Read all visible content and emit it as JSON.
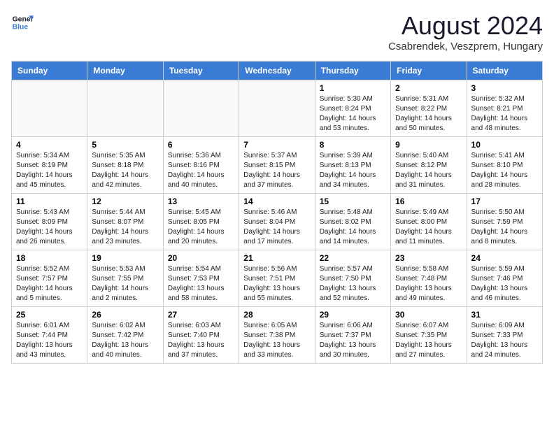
{
  "header": {
    "logo_line1": "General",
    "logo_line2": "Blue",
    "month_year": "August 2024",
    "location": "Csabrendek, Veszprem, Hungary"
  },
  "days_of_week": [
    "Sunday",
    "Monday",
    "Tuesday",
    "Wednesday",
    "Thursday",
    "Friday",
    "Saturday"
  ],
  "weeks": [
    [
      {
        "day": "",
        "info": ""
      },
      {
        "day": "",
        "info": ""
      },
      {
        "day": "",
        "info": ""
      },
      {
        "day": "",
        "info": ""
      },
      {
        "day": "1",
        "info": "Sunrise: 5:30 AM\nSunset: 8:24 PM\nDaylight: 14 hours\nand 53 minutes."
      },
      {
        "day": "2",
        "info": "Sunrise: 5:31 AM\nSunset: 8:22 PM\nDaylight: 14 hours\nand 50 minutes."
      },
      {
        "day": "3",
        "info": "Sunrise: 5:32 AM\nSunset: 8:21 PM\nDaylight: 14 hours\nand 48 minutes."
      }
    ],
    [
      {
        "day": "4",
        "info": "Sunrise: 5:34 AM\nSunset: 8:19 PM\nDaylight: 14 hours\nand 45 minutes."
      },
      {
        "day": "5",
        "info": "Sunrise: 5:35 AM\nSunset: 8:18 PM\nDaylight: 14 hours\nand 42 minutes."
      },
      {
        "day": "6",
        "info": "Sunrise: 5:36 AM\nSunset: 8:16 PM\nDaylight: 14 hours\nand 40 minutes."
      },
      {
        "day": "7",
        "info": "Sunrise: 5:37 AM\nSunset: 8:15 PM\nDaylight: 14 hours\nand 37 minutes."
      },
      {
        "day": "8",
        "info": "Sunrise: 5:39 AM\nSunset: 8:13 PM\nDaylight: 14 hours\nand 34 minutes."
      },
      {
        "day": "9",
        "info": "Sunrise: 5:40 AM\nSunset: 8:12 PM\nDaylight: 14 hours\nand 31 minutes."
      },
      {
        "day": "10",
        "info": "Sunrise: 5:41 AM\nSunset: 8:10 PM\nDaylight: 14 hours\nand 28 minutes."
      }
    ],
    [
      {
        "day": "11",
        "info": "Sunrise: 5:43 AM\nSunset: 8:09 PM\nDaylight: 14 hours\nand 26 minutes."
      },
      {
        "day": "12",
        "info": "Sunrise: 5:44 AM\nSunset: 8:07 PM\nDaylight: 14 hours\nand 23 minutes."
      },
      {
        "day": "13",
        "info": "Sunrise: 5:45 AM\nSunset: 8:05 PM\nDaylight: 14 hours\nand 20 minutes."
      },
      {
        "day": "14",
        "info": "Sunrise: 5:46 AM\nSunset: 8:04 PM\nDaylight: 14 hours\nand 17 minutes."
      },
      {
        "day": "15",
        "info": "Sunrise: 5:48 AM\nSunset: 8:02 PM\nDaylight: 14 hours\nand 14 minutes."
      },
      {
        "day": "16",
        "info": "Sunrise: 5:49 AM\nSunset: 8:00 PM\nDaylight: 14 hours\nand 11 minutes."
      },
      {
        "day": "17",
        "info": "Sunrise: 5:50 AM\nSunset: 7:59 PM\nDaylight: 14 hours\nand 8 minutes."
      }
    ],
    [
      {
        "day": "18",
        "info": "Sunrise: 5:52 AM\nSunset: 7:57 PM\nDaylight: 14 hours\nand 5 minutes."
      },
      {
        "day": "19",
        "info": "Sunrise: 5:53 AM\nSunset: 7:55 PM\nDaylight: 14 hours\nand 2 minutes."
      },
      {
        "day": "20",
        "info": "Sunrise: 5:54 AM\nSunset: 7:53 PM\nDaylight: 13 hours\nand 58 minutes."
      },
      {
        "day": "21",
        "info": "Sunrise: 5:56 AM\nSunset: 7:51 PM\nDaylight: 13 hours\nand 55 minutes."
      },
      {
        "day": "22",
        "info": "Sunrise: 5:57 AM\nSunset: 7:50 PM\nDaylight: 13 hours\nand 52 minutes."
      },
      {
        "day": "23",
        "info": "Sunrise: 5:58 AM\nSunset: 7:48 PM\nDaylight: 13 hours\nand 49 minutes."
      },
      {
        "day": "24",
        "info": "Sunrise: 5:59 AM\nSunset: 7:46 PM\nDaylight: 13 hours\nand 46 minutes."
      }
    ],
    [
      {
        "day": "25",
        "info": "Sunrise: 6:01 AM\nSunset: 7:44 PM\nDaylight: 13 hours\nand 43 minutes."
      },
      {
        "day": "26",
        "info": "Sunrise: 6:02 AM\nSunset: 7:42 PM\nDaylight: 13 hours\nand 40 minutes."
      },
      {
        "day": "27",
        "info": "Sunrise: 6:03 AM\nSunset: 7:40 PM\nDaylight: 13 hours\nand 37 minutes."
      },
      {
        "day": "28",
        "info": "Sunrise: 6:05 AM\nSunset: 7:38 PM\nDaylight: 13 hours\nand 33 minutes."
      },
      {
        "day": "29",
        "info": "Sunrise: 6:06 AM\nSunset: 7:37 PM\nDaylight: 13 hours\nand 30 minutes."
      },
      {
        "day": "30",
        "info": "Sunrise: 6:07 AM\nSunset: 7:35 PM\nDaylight: 13 hours\nand 27 minutes."
      },
      {
        "day": "31",
        "info": "Sunrise: 6:09 AM\nSunset: 7:33 PM\nDaylight: 13 hours\nand 24 minutes."
      }
    ]
  ]
}
